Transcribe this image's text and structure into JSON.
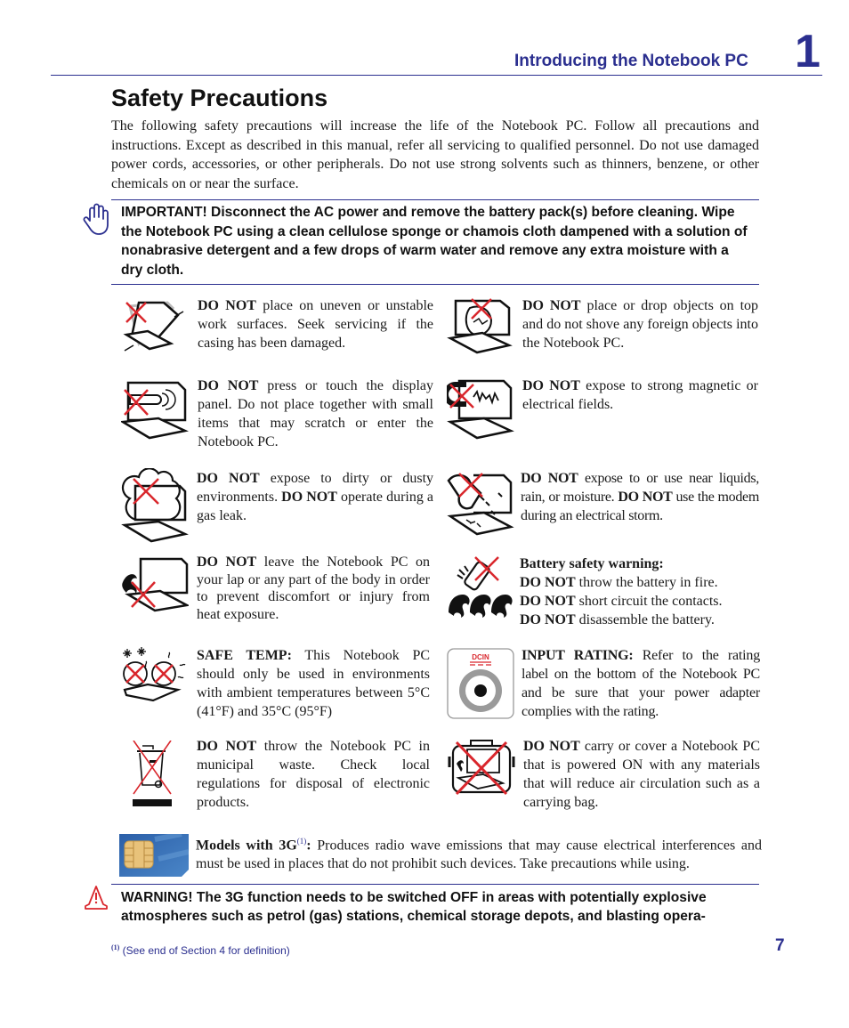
{
  "header": {
    "section_title": "Introducing the Notebook PC",
    "chapter_number": "1"
  },
  "page": {
    "title": "Safety Precautions",
    "intro": "The following safety precautions will increase the life of the Notebook PC. Follow all precautions and instructions. Except as described in this manual, refer all servicing to qualified personnel. Do not use damaged power cords, accessories, or other peripherals. Do not use strong solvents such as thinners, benzene, or other chemicals on or near the surface.",
    "page_number": "7"
  },
  "important_notice": {
    "icon": "hand-stop-icon",
    "text": "IMPORTANT!  Disconnect the AC power and remove the battery pack(s) before cleaning. Wipe the Notebook PC using a clean cellulose sponge or chamois cloth dampened with a solution of nonabrasive detergent and a few drops of warm water and remove any extra moisture with a dry cloth."
  },
  "precautions": [
    {
      "icon": "unstable-surface-icon",
      "bold": "DO NOT",
      "text": " place on uneven or unstable work surfaces. Seek servicing if the casing has been damaged."
    },
    {
      "icon": "objects-on-top-icon",
      "bold": "DO NOT",
      "text": " place or drop objects on top and do not shove any foreign objects into the Notebook PC."
    },
    {
      "icon": "touch-display-icon",
      "bold": "DO NOT",
      "text": " press or touch the display panel. Do not place together with small items that may scratch or enter the Notebook PC."
    },
    {
      "icon": "magnetic-field-icon",
      "bold": "DO NOT",
      "text": " expose to strong magnetic or electrical fields."
    },
    {
      "icon": "dust-icon",
      "bold": "DO NOT",
      "text": " expose to dirty or dusty environments. ",
      "bold2": "DO NOT",
      "text2": " operate during a gas leak."
    },
    {
      "icon": "liquid-icon",
      "bold": "DO NOT",
      "text": " expose to or use near liquids, rain, or moisture. ",
      "bold2": "DO NOT",
      "text2": " use the modem during an electrical storm."
    },
    {
      "icon": "heat-lap-icon",
      "bold": "DO NOT",
      "text": " leave the Notebook PC on your lap or any part of the body in order to prevent discomfort or injury from heat exposure."
    },
    {
      "icon": "battery-fire-icon",
      "heading": "Battery safety warning:",
      "lines": [
        {
          "bold": "DO NOT",
          "text": " throw the battery in fire."
        },
        {
          "bold": "DO NOT",
          "text": " short circuit the contacts."
        },
        {
          "bold": "DO NOT",
          "text": " disassemble the battery."
        }
      ]
    },
    {
      "icon": "temperature-icon",
      "bold": "SAFE TEMP:",
      "text": " This Notebook PC should only be used in environments with ambient temperatures between 5°C (41°F) and 35°C (95°F)"
    },
    {
      "icon": "dcin-icon",
      "icon_label": "DCIN",
      "bold": "INPUT RATING:",
      "text": " Refer to the rating label on the bottom of the Notebook PC and be sure that your power adapter complies with the rating."
    },
    {
      "icon": "crossed-bin-icon",
      "bold": "DO NOT",
      "text": " throw the Notebook PC in municipal waste. Check local regulations for disposal of electronic products."
    },
    {
      "icon": "carrying-bag-icon",
      "bold": "DO NOT",
      "text": " carry or cover a Notebook PC that is powered ON with any materials that will reduce air circulation such as a carrying bag."
    }
  ],
  "models_3g": {
    "icon": "sim-card-icon",
    "bold": "Models with 3G",
    "ref": "(1)",
    "colon": ":",
    "text": " Produces radio wave emissions that may cause electrical interferences and must be used in places that do not prohibit such devices. Take precautions while using."
  },
  "warning_notice": {
    "icon": "warning-cone-icon",
    "text": "WARNING! The 3G function needs to be switched OFF in areas with potentially explosive atmospheres such as petrol (gas) stations, chemical storage depots, and blasting opera-"
  },
  "footnote": {
    "ref": "(1)",
    "text": " (See end of Section 4 for definition)"
  },
  "colors": {
    "accent_blue": "#2b2f8f",
    "cross_red": "#d9262c"
  }
}
